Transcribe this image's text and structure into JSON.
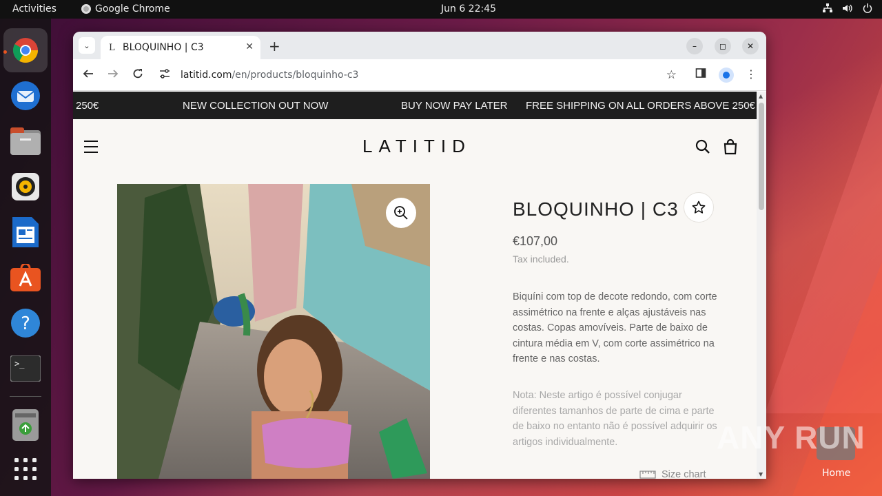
{
  "topbar": {
    "activities": "Activities",
    "app_name": "Google Chrome",
    "clock": "Jun 6  22:45"
  },
  "dock": {
    "items": [
      {
        "name": "chrome-icon"
      },
      {
        "name": "thunderbird-icon"
      },
      {
        "name": "files-icon"
      },
      {
        "name": "rhythmbox-icon"
      },
      {
        "name": "libreoffice-writer-icon"
      },
      {
        "name": "app-center-icon"
      },
      {
        "name": "help-icon"
      },
      {
        "name": "terminal-icon"
      },
      {
        "name": "trash-icon"
      },
      {
        "name": "show-apps-icon"
      }
    ]
  },
  "browser": {
    "tab_title": "BLOQUINHO | C3",
    "tab_favicon": "L",
    "url_host": "latitid.com",
    "url_path": "/en/products/bloquinho-c3"
  },
  "page": {
    "announcements": [
      "250€",
      "NEW COLLECTION OUT NOW",
      "BUY NOW PAY LATER",
      "FREE SHIPPING ON ALL ORDERS ABOVE 250€"
    ],
    "logo": "LATITID",
    "product": {
      "title": "BLOQUINHO | C3",
      "price": "€107,00",
      "tax_note": "Tax included.",
      "description": "Biquíni com top de decote redondo, com corte assimétrico na frente e alças ajustáveis nas costas. Copas amovíveis. Parte de baixo de cintura média em V, com corte assimétrico na frente e nas costas.",
      "note": "Nota: Neste artigo é possível conjugar diferentes tamanhos de parte de cima e parte de baixo no entanto não é possível adquirir os artigos individualmente.",
      "size_chart": "Size chart"
    }
  },
  "desktop": {
    "watermark": "ANY RUN",
    "home_label": "Home"
  },
  "colors": {
    "announce_bg": "#1e1e1e",
    "page_bg": "#f9f7f4",
    "ubuntu_orange": "#e95420"
  }
}
